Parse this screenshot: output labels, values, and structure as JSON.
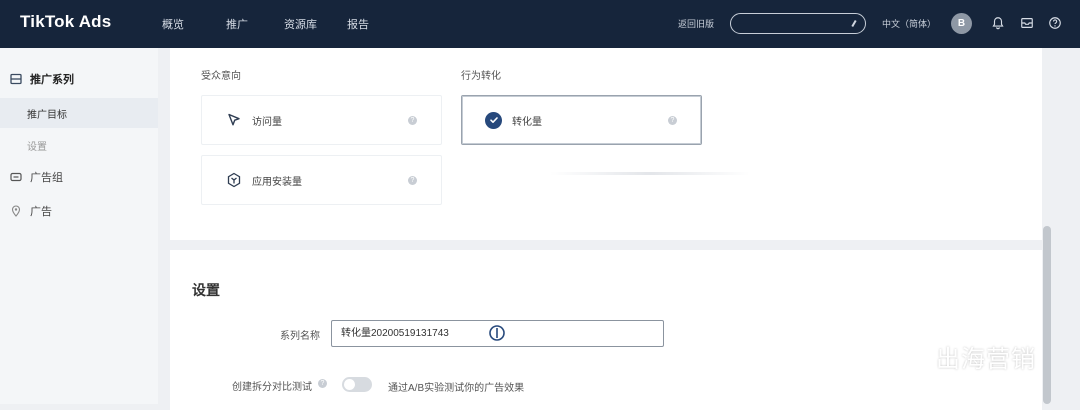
{
  "app": {
    "logo": "TikTok Ads",
    "nav": [
      "概览",
      "推广",
      "资源库",
      "报告"
    ],
    "return_old": "返回旧版",
    "language": "中文（简体）",
    "avatar_initial": "B",
    "icons": [
      "bell-icon",
      "inbox-icon",
      "help-icon"
    ]
  },
  "sidebar": {
    "items": [
      {
        "label": "推广系列",
        "icon": "campaign-icon"
      },
      {
        "label": "推广目标"
      },
      {
        "label": "设置"
      },
      {
        "label": "广告组",
        "icon": "adgroup-icon"
      },
      {
        "label": "广告",
        "icon": "ad-icon"
      }
    ]
  },
  "objectives": {
    "audience_title": "受众意向",
    "behavior_title": "行为转化",
    "options": [
      {
        "label": "访问量",
        "icon": "cursor-arrow-icon",
        "selected": false
      },
      {
        "label": "应用安装量",
        "icon": "app-box-icon",
        "selected": false
      },
      {
        "label": "转化量",
        "icon": "check-circle-icon",
        "selected": true
      }
    ],
    "help_glyph": "?"
  },
  "settings": {
    "title": "设置",
    "campaign_name_label": "系列名称",
    "campaign_name_value": "转化量20200519131743",
    "split_test_label": "创建拆分对比测试",
    "split_test_enabled": false,
    "split_test_desc": "通过A/B实验测试你的广告效果"
  },
  "watermark": {
    "text": "出海营销"
  },
  "colors": {
    "topbar": "#16253b",
    "accent": "#27497c",
    "background": "#eef0f3"
  }
}
